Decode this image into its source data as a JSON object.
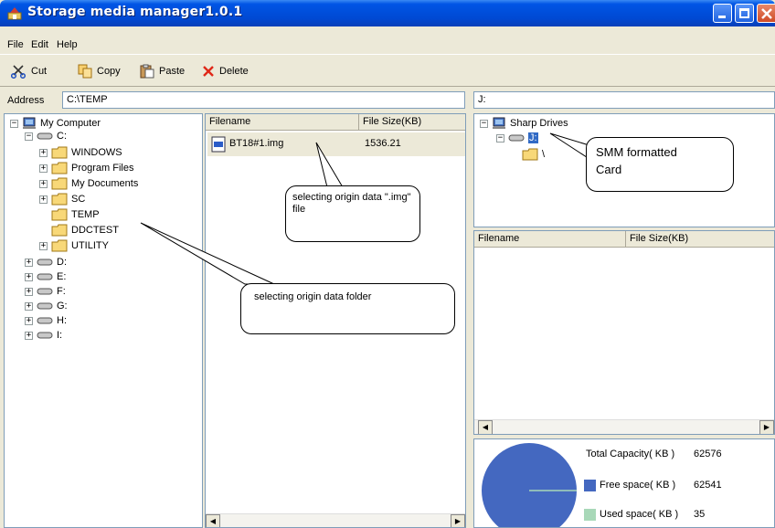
{
  "window": {
    "title": "Storage media manager1.0.1"
  },
  "menu": [
    "File",
    "Edit",
    "Help"
  ],
  "toolbar": {
    "cut": "Cut",
    "copy": "Copy",
    "paste": "Paste",
    "delete": "Delete"
  },
  "address": {
    "label": "Address",
    "value": "C:\\TEMP"
  },
  "right_address": {
    "value": "J:"
  },
  "left_tree": {
    "root": "My Computer",
    "drive_c": "C:",
    "folders": [
      "WINDOWS",
      "Program Files",
      "My Documents",
      "SC",
      "TEMP",
      "DDCTEST",
      "UTILITY"
    ],
    "drives": [
      "D:",
      "E:",
      "F:",
      "G:",
      "H:",
      "I:"
    ]
  },
  "file_list": {
    "col_filename": "Filename",
    "col_size": "File Size(KB)",
    "rows": [
      {
        "name": "BT18#1.img",
        "size": "1536.21"
      }
    ]
  },
  "right_tree": {
    "root": "Sharp Drives",
    "drive": "J:",
    "folder": "\\"
  },
  "right_file_list": {
    "col_filename": "Filename",
    "col_size": "File Size(KB)"
  },
  "capacity": {
    "total_label": "Total Capacity( KB )",
    "total_value": "62576",
    "free_label": "Free space( KB )",
    "free_value": "62541",
    "used_label": "Used space( KB )",
    "used_value": "35",
    "free_color": "#4468c0",
    "used_color": "#a8d8b8"
  },
  "callouts": {
    "img_file": "selecting origin data \".img\" file",
    "folder": "selecting origin data  folder",
    "card": "SMM formatted Card"
  }
}
